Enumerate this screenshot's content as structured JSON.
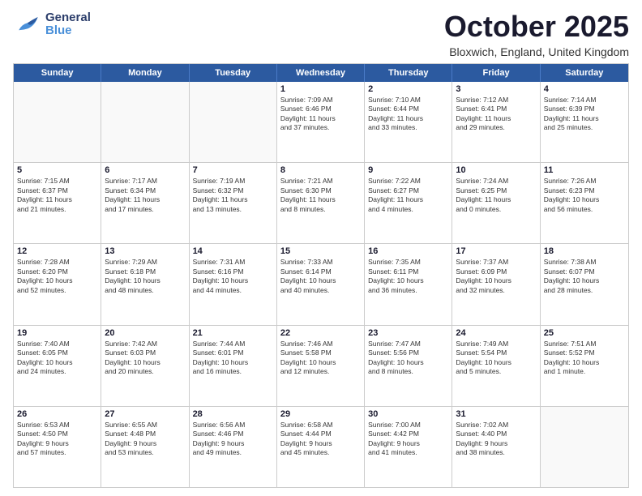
{
  "header": {
    "logo_general": "General",
    "logo_blue": "Blue",
    "month_title": "October 2025",
    "location": "Bloxwich, England, United Kingdom"
  },
  "weekdays": [
    "Sunday",
    "Monday",
    "Tuesday",
    "Wednesday",
    "Thursday",
    "Friday",
    "Saturday"
  ],
  "rows": [
    [
      {
        "day": "",
        "text": ""
      },
      {
        "day": "",
        "text": ""
      },
      {
        "day": "",
        "text": ""
      },
      {
        "day": "1",
        "text": "Sunrise: 7:09 AM\nSunset: 6:46 PM\nDaylight: 11 hours\nand 37 minutes."
      },
      {
        "day": "2",
        "text": "Sunrise: 7:10 AM\nSunset: 6:44 PM\nDaylight: 11 hours\nand 33 minutes."
      },
      {
        "day": "3",
        "text": "Sunrise: 7:12 AM\nSunset: 6:41 PM\nDaylight: 11 hours\nand 29 minutes."
      },
      {
        "day": "4",
        "text": "Sunrise: 7:14 AM\nSunset: 6:39 PM\nDaylight: 11 hours\nand 25 minutes."
      }
    ],
    [
      {
        "day": "5",
        "text": "Sunrise: 7:15 AM\nSunset: 6:37 PM\nDaylight: 11 hours\nand 21 minutes."
      },
      {
        "day": "6",
        "text": "Sunrise: 7:17 AM\nSunset: 6:34 PM\nDaylight: 11 hours\nand 17 minutes."
      },
      {
        "day": "7",
        "text": "Sunrise: 7:19 AM\nSunset: 6:32 PM\nDaylight: 11 hours\nand 13 minutes."
      },
      {
        "day": "8",
        "text": "Sunrise: 7:21 AM\nSunset: 6:30 PM\nDaylight: 11 hours\nand 8 minutes."
      },
      {
        "day": "9",
        "text": "Sunrise: 7:22 AM\nSunset: 6:27 PM\nDaylight: 11 hours\nand 4 minutes."
      },
      {
        "day": "10",
        "text": "Sunrise: 7:24 AM\nSunset: 6:25 PM\nDaylight: 11 hours\nand 0 minutes."
      },
      {
        "day": "11",
        "text": "Sunrise: 7:26 AM\nSunset: 6:23 PM\nDaylight: 10 hours\nand 56 minutes."
      }
    ],
    [
      {
        "day": "12",
        "text": "Sunrise: 7:28 AM\nSunset: 6:20 PM\nDaylight: 10 hours\nand 52 minutes."
      },
      {
        "day": "13",
        "text": "Sunrise: 7:29 AM\nSunset: 6:18 PM\nDaylight: 10 hours\nand 48 minutes."
      },
      {
        "day": "14",
        "text": "Sunrise: 7:31 AM\nSunset: 6:16 PM\nDaylight: 10 hours\nand 44 minutes."
      },
      {
        "day": "15",
        "text": "Sunrise: 7:33 AM\nSunset: 6:14 PM\nDaylight: 10 hours\nand 40 minutes."
      },
      {
        "day": "16",
        "text": "Sunrise: 7:35 AM\nSunset: 6:11 PM\nDaylight: 10 hours\nand 36 minutes."
      },
      {
        "day": "17",
        "text": "Sunrise: 7:37 AM\nSunset: 6:09 PM\nDaylight: 10 hours\nand 32 minutes."
      },
      {
        "day": "18",
        "text": "Sunrise: 7:38 AM\nSunset: 6:07 PM\nDaylight: 10 hours\nand 28 minutes."
      }
    ],
    [
      {
        "day": "19",
        "text": "Sunrise: 7:40 AM\nSunset: 6:05 PM\nDaylight: 10 hours\nand 24 minutes."
      },
      {
        "day": "20",
        "text": "Sunrise: 7:42 AM\nSunset: 6:03 PM\nDaylight: 10 hours\nand 20 minutes."
      },
      {
        "day": "21",
        "text": "Sunrise: 7:44 AM\nSunset: 6:01 PM\nDaylight: 10 hours\nand 16 minutes."
      },
      {
        "day": "22",
        "text": "Sunrise: 7:46 AM\nSunset: 5:58 PM\nDaylight: 10 hours\nand 12 minutes."
      },
      {
        "day": "23",
        "text": "Sunrise: 7:47 AM\nSunset: 5:56 PM\nDaylight: 10 hours\nand 8 minutes."
      },
      {
        "day": "24",
        "text": "Sunrise: 7:49 AM\nSunset: 5:54 PM\nDaylight: 10 hours\nand 5 minutes."
      },
      {
        "day": "25",
        "text": "Sunrise: 7:51 AM\nSunset: 5:52 PM\nDaylight: 10 hours\nand 1 minute."
      }
    ],
    [
      {
        "day": "26",
        "text": "Sunrise: 6:53 AM\nSunset: 4:50 PM\nDaylight: 9 hours\nand 57 minutes."
      },
      {
        "day": "27",
        "text": "Sunrise: 6:55 AM\nSunset: 4:48 PM\nDaylight: 9 hours\nand 53 minutes."
      },
      {
        "day": "28",
        "text": "Sunrise: 6:56 AM\nSunset: 4:46 PM\nDaylight: 9 hours\nand 49 minutes."
      },
      {
        "day": "29",
        "text": "Sunrise: 6:58 AM\nSunset: 4:44 PM\nDaylight: 9 hours\nand 45 minutes."
      },
      {
        "day": "30",
        "text": "Sunrise: 7:00 AM\nSunset: 4:42 PM\nDaylight: 9 hours\nand 41 minutes."
      },
      {
        "day": "31",
        "text": "Sunrise: 7:02 AM\nSunset: 4:40 PM\nDaylight: 9 hours\nand 38 minutes."
      },
      {
        "day": "",
        "text": ""
      }
    ]
  ]
}
